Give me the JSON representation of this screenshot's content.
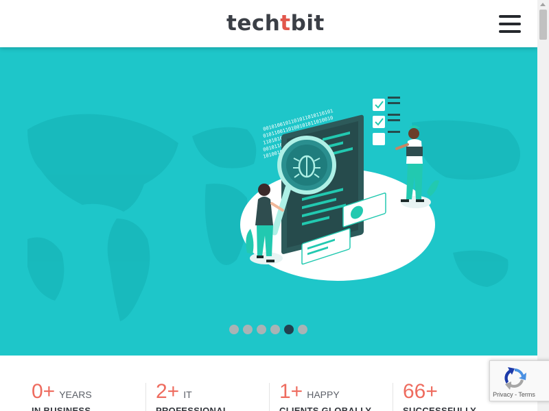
{
  "header": {
    "logo_part1": "tech",
    "logo_accent": "t",
    "logo_part2": "bit",
    "colors": {
      "logo_text": "#3b3f46",
      "logo_accent": "#e2574c"
    }
  },
  "hero": {
    "background_color": "#1ec6c9",
    "carousel": {
      "slide_count": 6,
      "active_index": 4
    }
  },
  "stats": [
    {
      "value": "0+",
      "label": "YEARS",
      "sub": "IN BUSINESS"
    },
    {
      "value": "2+",
      "label": "IT",
      "sub": "PROFESSIONAL"
    },
    {
      "value": "1+",
      "label": "HAPPY",
      "sub": "CLIENTS GLOBALLY"
    },
    {
      "value": "66+",
      "label": "",
      "sub": "SUCCESSFULLY"
    }
  ],
  "recaptcha": {
    "privacy": "Privacy",
    "separator": " - ",
    "terms": "Terms"
  }
}
